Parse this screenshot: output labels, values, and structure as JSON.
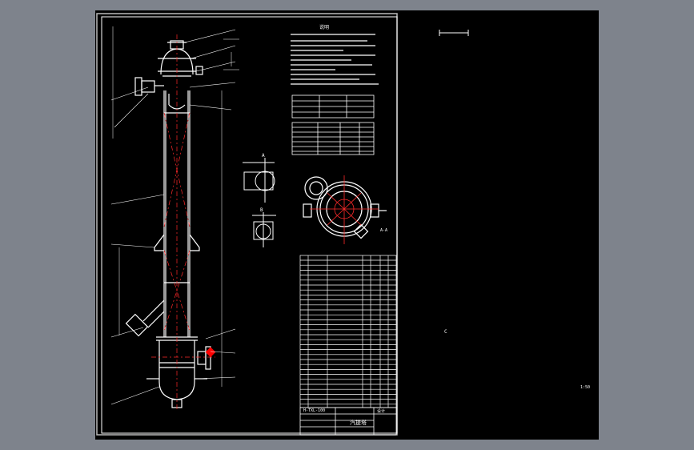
{
  "colors": {
    "desktop": "#7e838c",
    "canvas": "#000000",
    "line": "#ffffff",
    "centerline": "#ff2a2a",
    "fill_red": "#ff0000"
  },
  "sheet": {
    "notes_title": "说明",
    "section_mark_a": "A",
    "section_mark_b": "B",
    "scale_label": "A-A",
    "title_block": {
      "drawing_name": "汽提塔",
      "company": "",
      "label_left": "H-TXL-100",
      "label_right": "设计"
    }
  },
  "model_space": {
    "marker_c": "C",
    "corner_label": "1:50"
  }
}
